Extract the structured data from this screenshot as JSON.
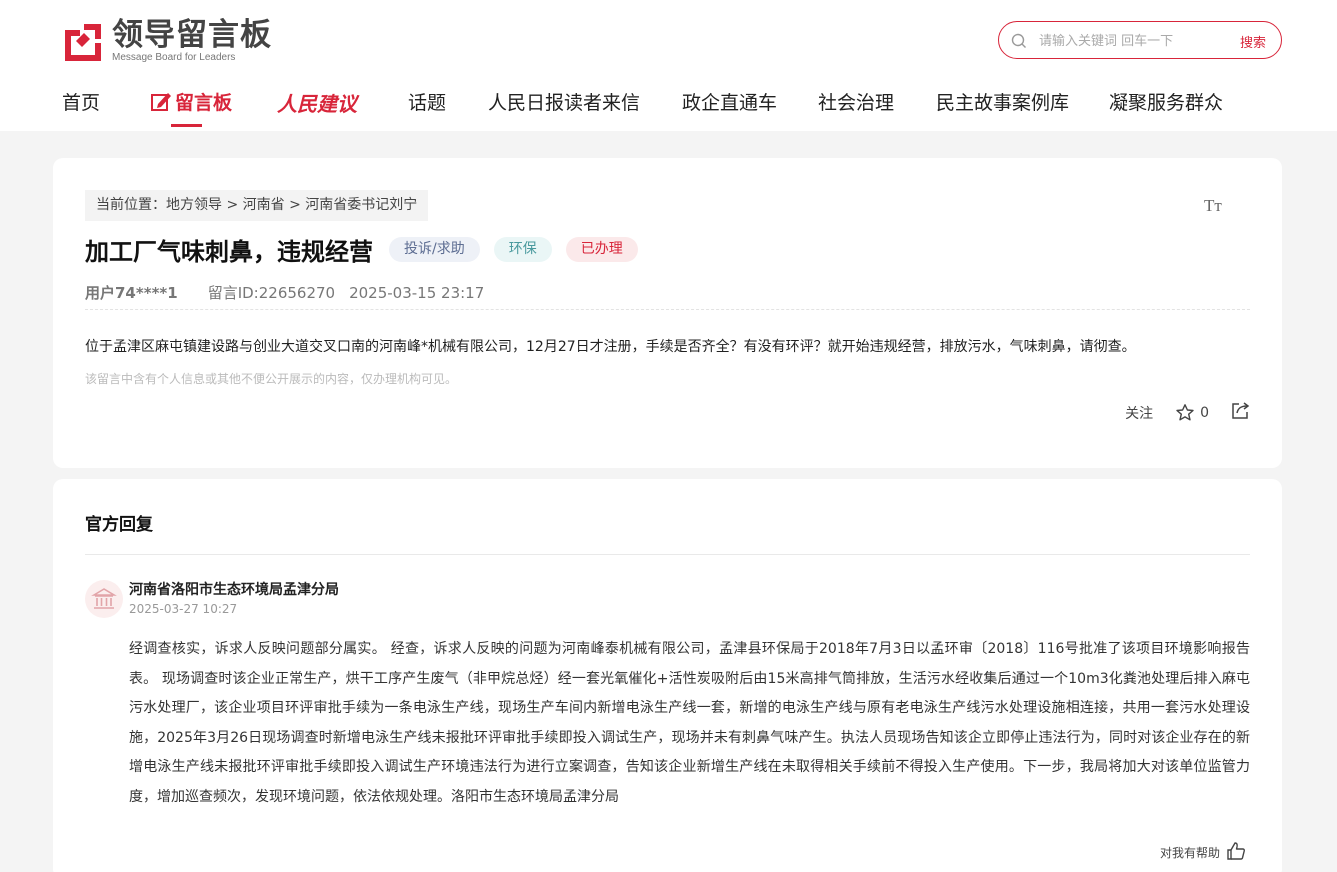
{
  "brand": {
    "title": "领导留言板",
    "subtitle": "Message Board for Leaders",
    "color": "#d8253a"
  },
  "search": {
    "placeholder": "请输入关键词 回车一下",
    "button": "搜索"
  },
  "nav": {
    "items": [
      "首页",
      "留言板",
      "人民建议",
      "话题",
      "人民日报读者来信",
      "政企直通车",
      "社会治理",
      "民主故事案例库",
      "凝聚服务群众"
    ],
    "active_index": 1
  },
  "breadcrumb": {
    "prefix": "当前位置：",
    "items": [
      "地方领导",
      "河南省",
      "河南省委书记刘宁"
    ],
    "separator": ">"
  },
  "message": {
    "title": "加工厂气味刺鼻，违规经营",
    "tags": [
      "投诉/求助",
      "环保",
      "已办理"
    ],
    "user": "用户74****1",
    "id": "留言ID:22656270",
    "datetime": "2025-03-15 23:17",
    "content": "位于孟津区麻屯镇建设路与创业大道交叉口南的河南峰*机械有限公司，12月27日才注册，手续是否齐全？有没有环评？就开始违规经营，排放污水，气味刺鼻，请彻查。",
    "notice": "该留言中含有个人信息或其他不便公开展示的内容，仅办理机构可见。",
    "follow_label": "关注",
    "star_count": "0",
    "font_size_icon": "Tт"
  },
  "reply": {
    "section_title": "官方回复",
    "org": "河南省洛阳市生态环境局孟津分局",
    "datetime": "2025-03-27 10:27",
    "body": "经调查核实，诉求人反映问题部分属实。 经查，诉求人反映的问题为河南峰泰机械有限公司，孟津县环保局于2018年7月3日以孟环审〔2018〕116号批准了该项目环境影响报告表。 现场调查时该企业正常生产，烘干工序产生废气（非甲烷总烃）经一套光氧催化+活性炭吸附后由15米高排气筒排放，生活污水经收集后通过一个10m3化粪池处理后排入麻屯污水处理厂，该企业项目环评审批手续为一条电泳生产线，现场生产车间内新增电泳生产线一套，新增的电泳生产线与原有老电泳生产线污水处理设施相连接，共用一套污水处理设施，2025年3月26日现场调查时新增电泳生产线未报批环评审批手续即投入调试生产，现场并未有刺鼻气味产生。执法人员现场告知该企立即停止违法行为，同时对该企业存在的新增电泳生产线未报批环评审批手续即投入调试生产环境违法行为进行立案调查，告知该企业新增生产线在未取得相关手续前不得投入生产使用。下一步，我局将加大对该单位监管力度，增加巡查频次，发现环境问题，依法依规处理。洛阳市生态环境局孟津分局",
    "helpful_label": "对我有帮助"
  }
}
